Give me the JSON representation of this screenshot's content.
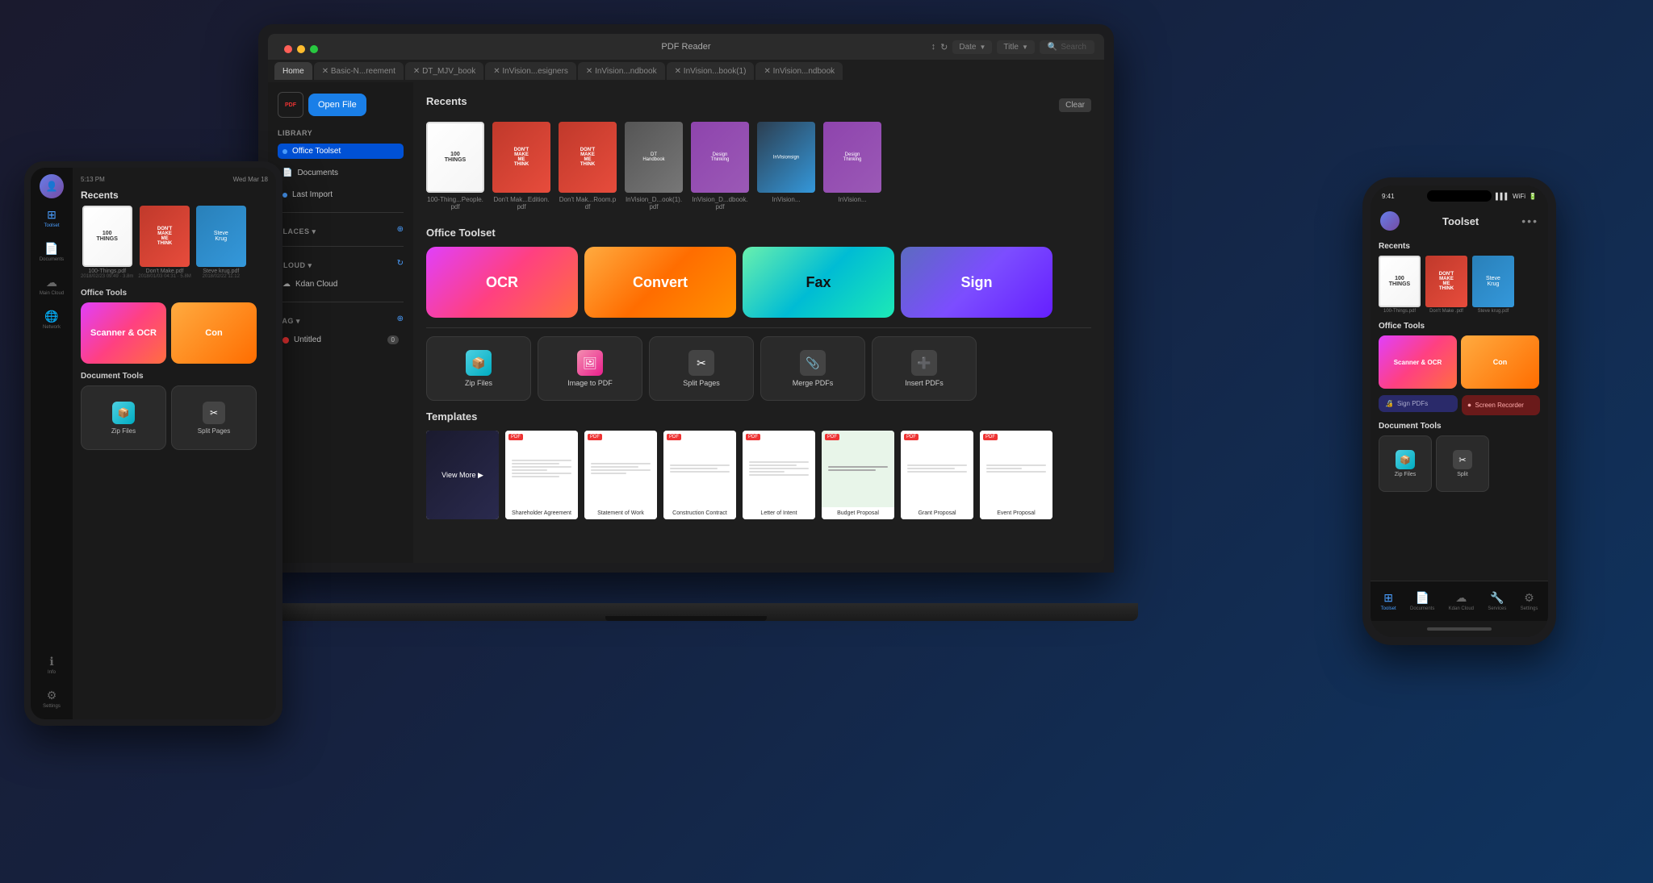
{
  "app": {
    "title": "PDF Reader"
  },
  "laptop": {
    "title": "PDF Reader",
    "tabs": [
      {
        "label": "Home",
        "active": true,
        "closable": false
      },
      {
        "label": "Basic-N...reement",
        "active": false,
        "closable": true
      },
      {
        "label": "DT_MJV_book",
        "active": false,
        "closable": true
      },
      {
        "label": "InVision...esigners",
        "active": false,
        "closable": true
      },
      {
        "label": "InVision...ndbook",
        "active": false,
        "closable": true
      },
      {
        "label": "InVision...book(1)",
        "active": false,
        "closable": true
      },
      {
        "label": "InVision...ndbook",
        "active": false,
        "closable": true
      }
    ],
    "sidebar": {
      "open_file": "Open File",
      "library_title": "LIBRARY",
      "library_items": [
        {
          "label": "Office Toolset",
          "active": true
        },
        {
          "label": "Documents",
          "active": false
        },
        {
          "label": "Last Import",
          "active": false
        }
      ],
      "places_title": "PLACES",
      "cloud_title": "CLOUD",
      "cloud_items": [
        {
          "label": "Kdan Cloud"
        }
      ],
      "tag_title": "TAG",
      "tag_items": [
        {
          "label": "Untitled",
          "count": "0"
        }
      ]
    },
    "recents": {
      "title": "Recents",
      "clear_label": "Clear",
      "items": [
        {
          "label": "100-Thing...People.pdf",
          "book": "100things"
        },
        {
          "label": "Don't Mak...Edition.pdf",
          "book": "dmmt-red"
        },
        {
          "label": "Don't Mak...Room.pdf",
          "book": "dmmt-red"
        },
        {
          "label": "InVision_D...ook(1).pdf",
          "book": "invision"
        },
        {
          "label": "InVision_D...dbook.pdf",
          "book": "design"
        },
        {
          "label": "InVision...",
          "book": "design"
        }
      ]
    },
    "office_toolset": {
      "title": "Office Toolset",
      "tools_large": [
        {
          "label": "OCR",
          "style": "ocr"
        },
        {
          "label": "Convert",
          "style": "convert"
        },
        {
          "label": "Fax",
          "style": "fax"
        },
        {
          "label": "Sign",
          "style": "sign"
        }
      ],
      "tools_small": [
        {
          "label": "Zip Files",
          "icon": "📦",
          "style": "zip"
        },
        {
          "label": "Image to PDF",
          "icon": "🖼",
          "style": "img-to-pdf"
        },
        {
          "label": "Split Pages",
          "icon": "✂",
          "style": "split"
        },
        {
          "label": "Merge PDFs",
          "icon": "📎",
          "style": "merge"
        },
        {
          "label": "Insert PDFs",
          "icon": "➕",
          "style": "insert"
        }
      ]
    },
    "templates": {
      "title": "Templates",
      "items": [
        {
          "label": "View More ▶",
          "type": "view-more"
        },
        {
          "label": "Shareholder Agreement",
          "tag": "PDF"
        },
        {
          "label": "Statement of Work",
          "tag": "PDF"
        },
        {
          "label": "Construction Contract",
          "tag": "PDF"
        },
        {
          "label": "Letter of Intent",
          "tag": "PDF"
        },
        {
          "label": "Budget Proposal",
          "tag": "PDF"
        },
        {
          "label": "Grant Proposal",
          "tag": "PDF"
        },
        {
          "label": "Event Proposal",
          "tag": "PDF"
        }
      ]
    }
  },
  "ipad": {
    "status_time": "5:13 PM",
    "status_date": "Wed Mar 18",
    "nav_items": [
      {
        "label": "Toolset",
        "icon": "⊞",
        "active": true
      },
      {
        "label": "Documents",
        "icon": "📄",
        "active": false
      },
      {
        "label": "Main Cloud",
        "icon": "☁",
        "active": false
      },
      {
        "label": "Network",
        "icon": "🌐",
        "active": false
      },
      {
        "label": "Information",
        "icon": "ℹ",
        "active": false
      },
      {
        "label": "Settings",
        "icon": "⚙",
        "active": false
      }
    ],
    "recents_title": "Recents",
    "recents": [
      {
        "label": "100-Things.pdf",
        "date": "2018/02/23 09:49",
        "size": "3.8m"
      },
      {
        "label": "Don't Make.pdf",
        "date": "2018/01/03 04:31",
        "size": "5.8M"
      },
      {
        "label": "Steve krug.pdf",
        "date": "2018/02/22 11:12"
      }
    ],
    "office_tools_title": "Office Tools",
    "tools": [
      {
        "label": "Scanner & OCR",
        "style": "ocr"
      },
      {
        "label": "Con",
        "style": "con"
      }
    ],
    "doc_tools_title": "Document Tools",
    "doc_tools": [
      {
        "label": "Zip Files",
        "icon": "📦",
        "style": "zip"
      },
      {
        "label": "Split Pages",
        "icon": "✂",
        "style": "split"
      }
    ]
  },
  "iphone": {
    "status_time": "9:41",
    "status_signal": "▌▌▌",
    "status_wifi": "WiFi",
    "status_battery": "🔋",
    "title": "Toolset",
    "recents_title": "Recents",
    "recents": [
      {
        "label": "100-Things.pdf",
        "book": "100things"
      },
      {
        "label": "Don't Make .pdf",
        "book": "dmmt-red"
      },
      {
        "label": "Steve krug.pdf",
        "book": "krug"
      }
    ],
    "office_tools_title": "Office Tools",
    "tools": [
      {
        "label": "Scanner & OCR",
        "style": "scanner-ocr"
      },
      {
        "label": "Con",
        "style": "con"
      }
    ],
    "sign_label": "Sign PDFs",
    "screen_rec_label": "Screen Recorder",
    "doc_tools_title": "Document Tools",
    "doc_tools": [
      {
        "label": "Zip Files",
        "style": "zip"
      },
      {
        "label": "Split",
        "style": "split"
      }
    ],
    "nav_items": [
      {
        "label": "Toolset",
        "icon": "⊞",
        "active": true
      },
      {
        "label": "Documents",
        "icon": "📄",
        "active": false
      },
      {
        "label": "Kdan Cloud",
        "icon": "☁",
        "active": false
      },
      {
        "label": "Services",
        "icon": "🔧",
        "active": false
      },
      {
        "label": "Settings",
        "icon": "⚙",
        "active": false
      }
    ]
  }
}
